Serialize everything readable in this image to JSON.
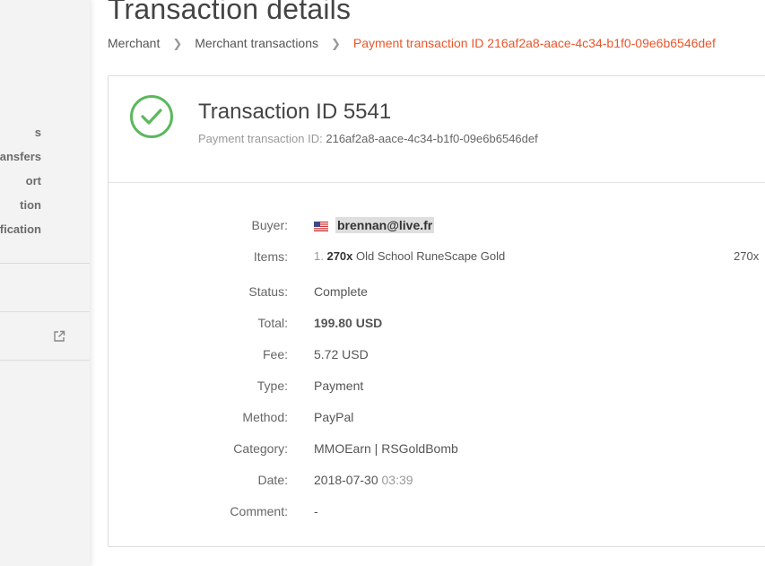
{
  "sidebar": {
    "items": [
      {
        "label": "s"
      },
      {
        "label": "ransfers"
      },
      {
        "label": "ort"
      },
      {
        "label": "tion"
      },
      {
        "label": "fication"
      }
    ],
    "external_icon": "external-link-icon"
  },
  "header": {
    "title": "Transaction details",
    "breadcrumb": [
      {
        "label": "Merchant"
      },
      {
        "label": "Merchant transactions"
      },
      {
        "label": "Payment transaction ID 216af2a8-aace-4c34-b1f0-09e6b6546def"
      }
    ]
  },
  "transaction": {
    "title": "Transaction ID 5541",
    "subtitle_label": "Payment transaction ID:",
    "subtitle_value": "216af2a8-aace-4c34-b1f0-09e6b6546def",
    "status_icon": "check-circle-icon",
    "status_color": "#5cb85c"
  },
  "details": {
    "buyer": {
      "label": "Buyer:",
      "email": "brennan@live.fr",
      "flag": "us-flag-icon"
    },
    "items": {
      "label": "Items:",
      "index": "1.",
      "qty": "270x",
      "name": "Old School RuneScape Gold",
      "right_qty": "270x"
    },
    "status": {
      "label": "Status:",
      "value": "Complete"
    },
    "total": {
      "label": "Total:",
      "value": "199.80 USD"
    },
    "fee": {
      "label": "Fee:",
      "value": "5.72 USD"
    },
    "type": {
      "label": "Type:",
      "value": "Payment"
    },
    "method": {
      "label": "Method:",
      "value": "PayPal"
    },
    "category": {
      "label": "Category:",
      "value": "MMOEarn | RSGoldBomb"
    },
    "date": {
      "label": "Date:",
      "date": "2018-07-30",
      "time": "03:39"
    },
    "comment": {
      "label": "Comment:",
      "value": "-"
    }
  },
  "colors": {
    "accent": "#e8562a",
    "success": "#5cb85c"
  }
}
